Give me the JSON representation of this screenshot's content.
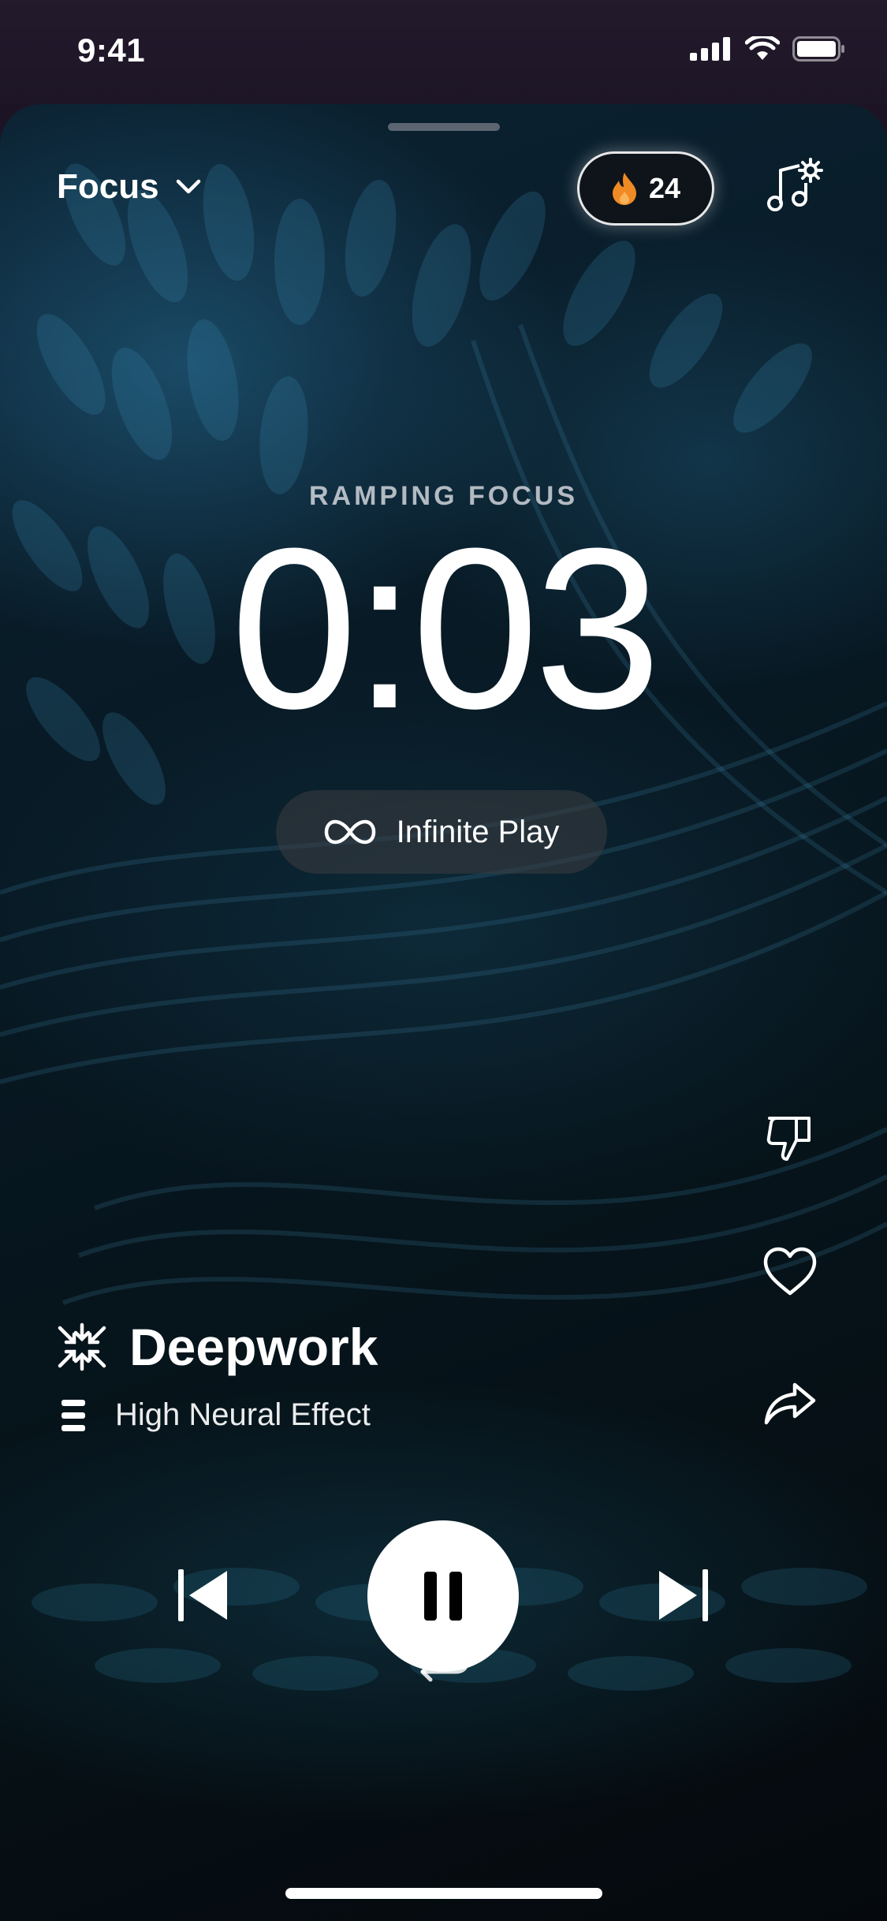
{
  "status_bar": {
    "time": "9:41"
  },
  "header": {
    "mode_label": "Focus",
    "streak_count": "24"
  },
  "session": {
    "ramp_label": "RAMPING FOCUS",
    "timer": "0:03",
    "infinite_play_label": "Infinite Play"
  },
  "track": {
    "title": "Deepwork",
    "subtitle": "High Neural Effect"
  },
  "icons": {
    "mode_chevron": "chevron-down-icon",
    "streak": "flame-icon",
    "settings": "music-settings-icon",
    "infinite": "infinity-icon",
    "dislike": "thumbs-down-icon",
    "like": "heart-icon",
    "share": "share-icon",
    "activity": "compress-icon",
    "effect": "bars-icon",
    "prev": "skip-previous-icon",
    "pause": "pause-icon",
    "next": "skip-next-icon",
    "repeat": "repeat-icon"
  },
  "colors": {
    "flame": "#f08a24",
    "background": "#071822",
    "accent": "#ffffff"
  }
}
